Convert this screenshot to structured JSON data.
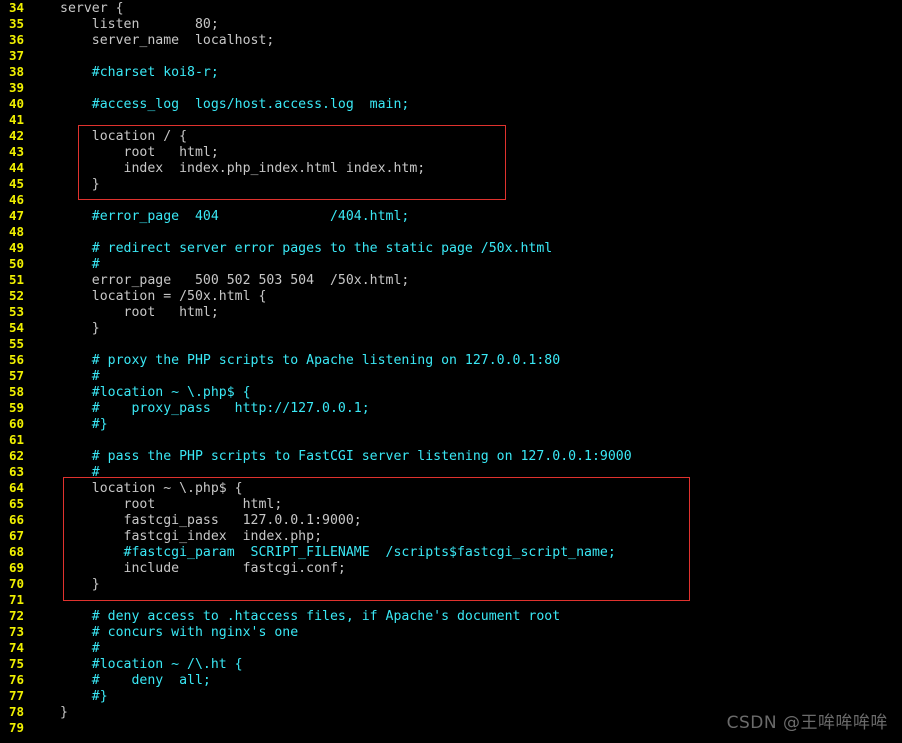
{
  "editor": {
    "background_color": "#000000",
    "line_number_color": "#f0f000",
    "code_color": "#c7c7c7",
    "comment_color": "#3ae8f5",
    "highlight_color": "#e0322e",
    "first_line_number": 34,
    "last_line_number": 79
  },
  "lines": [
    {
      "num": "34",
      "text": "server {",
      "kind": "plain"
    },
    {
      "num": "35",
      "text": "    listen       80;",
      "kind": "plain"
    },
    {
      "num": "36",
      "text": "    server_name  localhost;",
      "kind": "plain"
    },
    {
      "num": "37",
      "text": "",
      "kind": "plain"
    },
    {
      "num": "38",
      "text": "    #charset koi8-r;",
      "kind": "comment"
    },
    {
      "num": "39",
      "text": "",
      "kind": "plain"
    },
    {
      "num": "40",
      "text": "    #access_log  logs/host.access.log  main;",
      "kind": "comment"
    },
    {
      "num": "41",
      "text": "",
      "kind": "plain"
    },
    {
      "num": "42",
      "text": "    location / {",
      "kind": "plain"
    },
    {
      "num": "43",
      "text": "        root   html;",
      "kind": "plain"
    },
    {
      "num": "44",
      "text": "        index  index.php_index.html index.htm;",
      "kind": "plain"
    },
    {
      "num": "45",
      "text": "    }",
      "kind": "plain"
    },
    {
      "num": "46",
      "text": "",
      "kind": "plain"
    },
    {
      "num": "47",
      "text": "    #error_page  404              /404.html;",
      "kind": "comment"
    },
    {
      "num": "48",
      "text": "",
      "kind": "plain"
    },
    {
      "num": "49",
      "text": "    # redirect server error pages to the static page /50x.html",
      "kind": "comment"
    },
    {
      "num": "50",
      "text": "    #",
      "kind": "comment"
    },
    {
      "num": "51",
      "text": "    error_page   500 502 503 504  /50x.html;",
      "kind": "plain"
    },
    {
      "num": "52",
      "text": "    location = /50x.html {",
      "kind": "plain"
    },
    {
      "num": "53",
      "text": "        root   html;",
      "kind": "plain"
    },
    {
      "num": "54",
      "text": "    }",
      "kind": "plain"
    },
    {
      "num": "55",
      "text": "",
      "kind": "plain"
    },
    {
      "num": "56",
      "text": "    # proxy the PHP scripts to Apache listening on 127.0.0.1:80",
      "kind": "comment"
    },
    {
      "num": "57",
      "text": "    #",
      "kind": "comment"
    },
    {
      "num": "58",
      "text": "    #location ~ \\.php$ {",
      "kind": "comment"
    },
    {
      "num": "59",
      "text": "    #    proxy_pass   http://127.0.0.1;",
      "kind": "comment"
    },
    {
      "num": "60",
      "text": "    #}",
      "kind": "comment"
    },
    {
      "num": "61",
      "text": "",
      "kind": "plain"
    },
    {
      "num": "62",
      "text": "    # pass the PHP scripts to FastCGI server listening on 127.0.0.1:9000",
      "kind": "comment"
    },
    {
      "num": "63",
      "text": "    #",
      "kind": "comment"
    },
    {
      "num": "64",
      "text": "    location ~ \\.php$ {",
      "kind": "plain"
    },
    {
      "num": "65",
      "text": "        root           html;",
      "kind": "plain"
    },
    {
      "num": "66",
      "text": "        fastcgi_pass   127.0.0.1:9000;",
      "kind": "plain"
    },
    {
      "num": "67",
      "text": "        fastcgi_index  index.php;",
      "kind": "plain"
    },
    {
      "num": "68",
      "text": "        #fastcgi_param  SCRIPT_FILENAME  /scripts$fastcgi_script_name;",
      "kind": "comment"
    },
    {
      "num": "69",
      "text": "        include        fastcgi.conf;",
      "kind": "plain"
    },
    {
      "num": "70",
      "text": "    }",
      "kind": "plain"
    },
    {
      "num": "71",
      "text": "",
      "kind": "plain"
    },
    {
      "num": "72",
      "text": "    # deny access to .htaccess files, if Apache's document root",
      "kind": "comment"
    },
    {
      "num": "73",
      "text": "    # concurs with nginx's one",
      "kind": "comment"
    },
    {
      "num": "74",
      "text": "    #",
      "kind": "comment"
    },
    {
      "num": "75",
      "text": "    #location ~ /\\.ht {",
      "kind": "comment"
    },
    {
      "num": "76",
      "text": "    #    deny  all;",
      "kind": "comment"
    },
    {
      "num": "77",
      "text": "    #}",
      "kind": "comment"
    },
    {
      "num": "78",
      "text": "}",
      "kind": "plain"
    },
    {
      "num": "79",
      "text": "",
      "kind": "plain"
    }
  ],
  "highlights": [
    {
      "label": "location-block-highlight",
      "lines": "42-45"
    },
    {
      "label": "fastcgi-location-block-highlight",
      "lines": "64-70"
    }
  ],
  "watermark": {
    "text": "CSDN @王哞哞哞哞"
  }
}
